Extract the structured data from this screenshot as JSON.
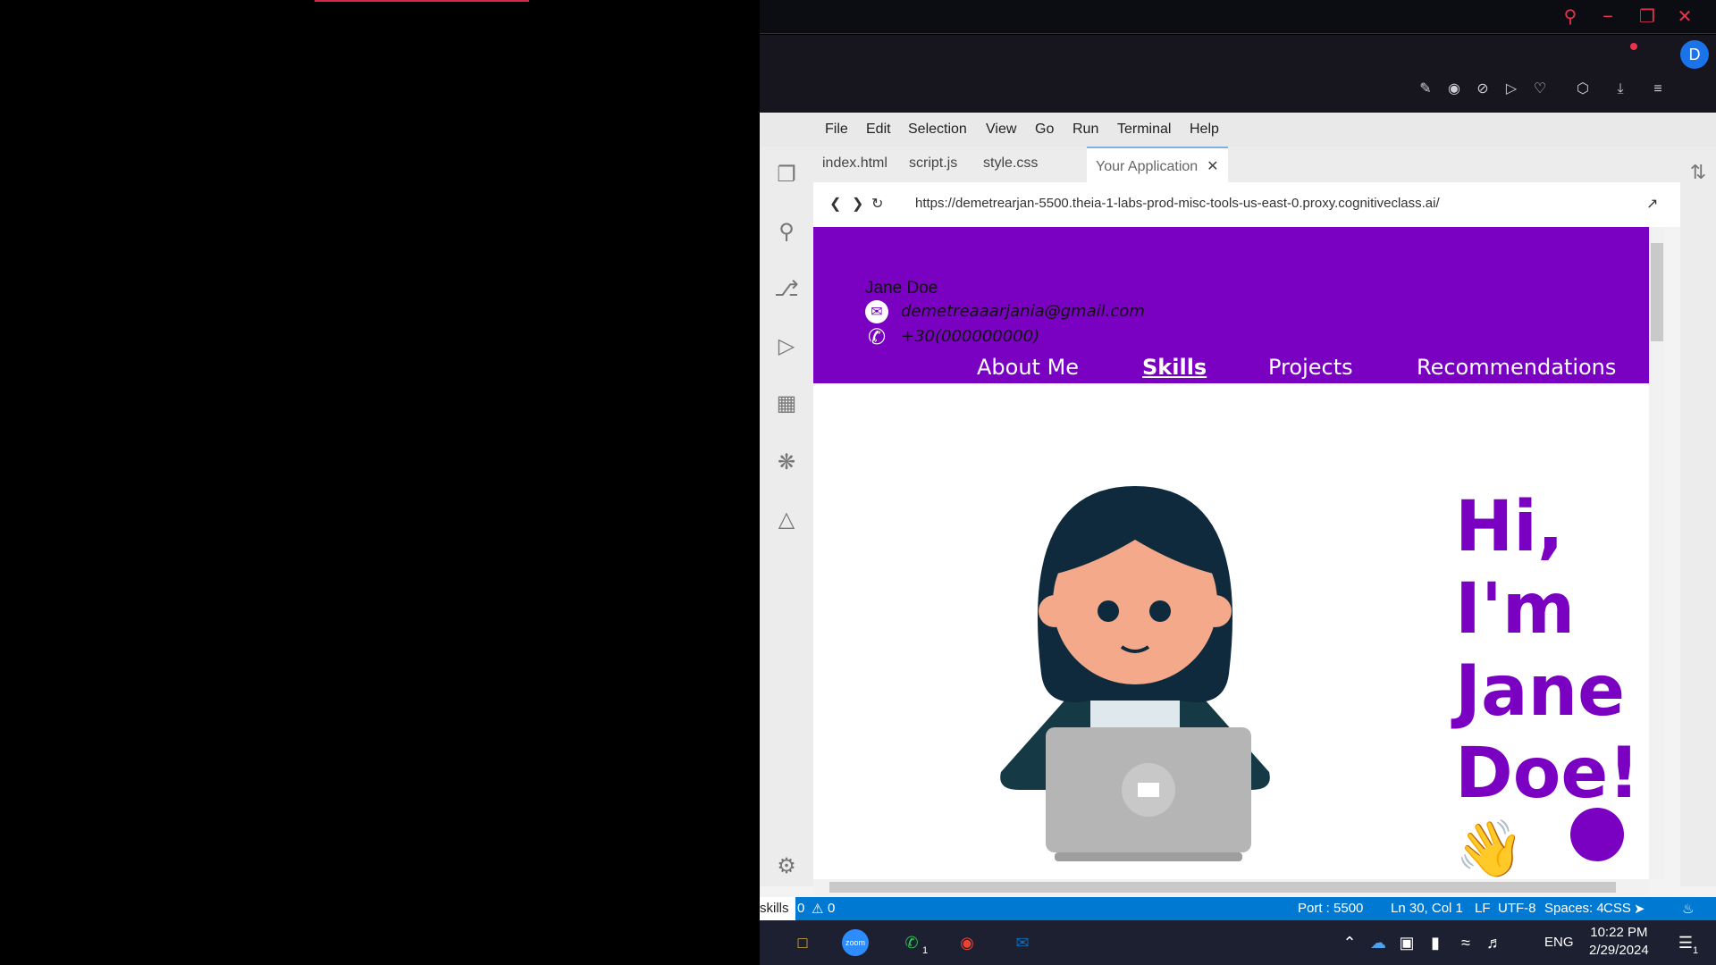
{
  "window": {
    "title": "Your Application"
  },
  "menu": [
    "File",
    "Edit",
    "Selection",
    "View",
    "Go",
    "Run",
    "Terminal",
    "Help"
  ],
  "tabs": [
    {
      "label": "index.html"
    },
    {
      "label": "script.js"
    },
    {
      "label": "style.css"
    },
    {
      "label": "Your Application",
      "active": true
    }
  ],
  "address": {
    "url": "https://demetrearjan-5500.theia-1-labs-prod-misc-tools-us-east-0.proxy.cognitiveclass.ai/"
  },
  "site": {
    "name": "Jane Doe",
    "email": "demetreaaarjania@gmail.com",
    "phone": "+30(000000000)",
    "nav": [
      "About Me",
      "Skills",
      "Projects",
      "Recommendations"
    ],
    "active_nav": "Skills",
    "greeting_lines": [
      "Hi,",
      "I'm",
      "Jane",
      "Doe!"
    ],
    "wave_emoji": "👋"
  },
  "statusbar": {
    "left_label": "skills",
    "problems": "0",
    "warnings": "0",
    "port": "Port : 5500",
    "position": "Ln 30, Col 1",
    "eol": "LF",
    "encoding": "UTF-8",
    "spaces": "Spaces: 4",
    "language": "CSS"
  },
  "taskbar": {
    "time": "10:22 PM",
    "date": "2/29/2024",
    "lang": "ENG",
    "notification_count": "1",
    "whatsapp_badge": "1",
    "zoom_label": "zoom"
  },
  "profile_initial": "D",
  "colors": {
    "accent": "#7a00c2",
    "status": "#0079d3"
  }
}
